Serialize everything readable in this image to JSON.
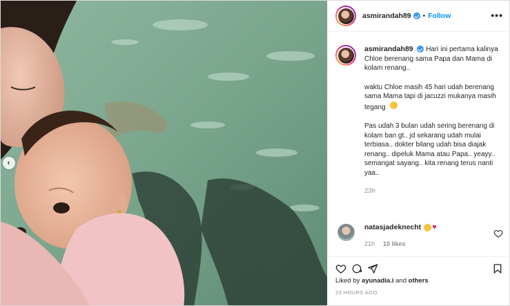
{
  "post": {
    "username": "asmirandah89",
    "follow_label": "Follow",
    "separator": "•",
    "more_label": "•••"
  },
  "caption": {
    "username": "asmirandah89",
    "paragraphs": [
      "Hari ini pertama kalinya Chloe berenang sama Papa dan Mama di kolam renang..",
      "waktu Chloe masih 45 hari udah berenang sama Mama tapi di jacuzzi mukanya masih tegang",
      "Pas udah 3 bulan udah sering berenang di kolam ban gt.. jd sekarang udah mulai terbiasa.. dokter bilang udah bisa diajak renang.. dipeluk Mama atau Papa.. yeayy.. semangat sayang.. kita renang terus nanti yaa.."
    ],
    "time": "23h"
  },
  "comment": {
    "username": "natasjadeknecht",
    "emoji_clap": "clapping-hands",
    "emoji_heart": "♥",
    "time": "21h",
    "likes": "10 likes"
  },
  "actions": {
    "icons": [
      "heart-icon",
      "comment-icon",
      "share-icon",
      "bookmark-icon"
    ],
    "liked_prefix": "Liked by",
    "liked_user": "ayunadia.i",
    "liked_and": "and",
    "liked_others": "others",
    "timestamp": "23 HOURS AGO"
  },
  "carousel": {
    "prev_arrow": "‹"
  },
  "colors": {
    "accent": "#0095f6",
    "verified": "#3897f0",
    "heart": "#e0245e",
    "muted": "#8e8e8e",
    "water": "#7fa58e"
  }
}
